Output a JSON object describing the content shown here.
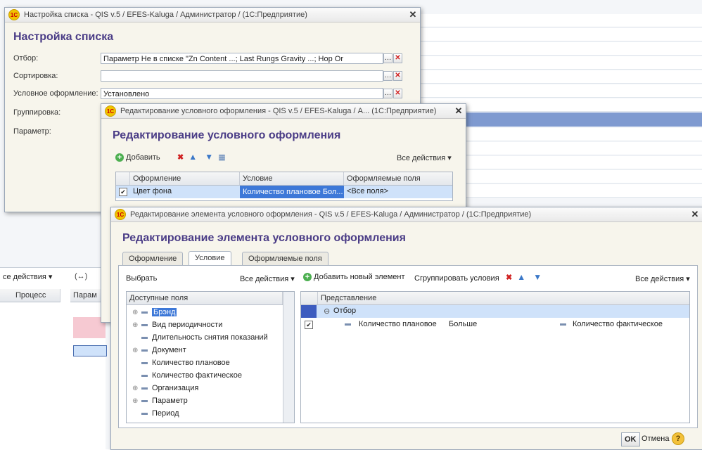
{
  "colors": {
    "heading": "#4a3c86",
    "selection": "#7f9ad0",
    "rowHighlight": "#cfe2fa"
  },
  "background": {
    "actions_label": "се действия ▾",
    "process_col": "Процесс",
    "param_col": "Парам",
    "arrows": "(↔)"
  },
  "win1": {
    "title": "Настройка списка - QIS v.5 / EFES-Kaluga / Администратор /  (1С:Предприятие)",
    "heading": "Настройка списка",
    "filter_label": "Отбор:",
    "filter_value": "Параметр Не в списке \"Zn Content            ...; Last Rungs Gravity      ...; Hop Or",
    "sort_label": "Сортировка:",
    "sort_value": "",
    "cond_label": "Условное оформление:",
    "cond_value": "Установлено",
    "group_label": "Группировка:",
    "param_label": "Параметр:"
  },
  "win2": {
    "title": "Редактирование условного оформления - QIS v.5 / EFES-Kaluga / А...  (1С:Предприятие)",
    "heading": "Редактирование условного оформления",
    "add_label": "Добавить",
    "all_actions": "Все действия ▾",
    "columns": [
      "Оформление",
      "Условие",
      "Оформляемые поля"
    ],
    "row": {
      "style": "Цвет фона",
      "condition": "Количество плановое Бол...",
      "fields": "<Все поля>"
    }
  },
  "win3": {
    "title": "Редактирование элемента условного оформления - QIS v.5 / EFES-Kaluga / Администратор /  (1С:Предприятие)",
    "heading": "Редактирование элемента условного оформления",
    "tabs": [
      "Оформление",
      "Условие",
      "Оформляемые поля"
    ],
    "select_label": "Выбрать",
    "all_actions_left": "Все действия ▾",
    "add_new": "Добавить новый элемент",
    "group_conditions": "Сгруппировать условия",
    "all_actions_right": "Все действия ▾",
    "fields_header": "Доступные поля",
    "fields": [
      "Брэнд",
      "Вид периодичности",
      "Длительность снятия показаний",
      "Документ",
      "Количество плановое",
      "Количество фактическое",
      "Организация",
      "Параметр",
      "Период"
    ],
    "repr_header": "Представление",
    "group_row": "Отбор",
    "cond_row": {
      "left": "Количество плановое",
      "op": "Больше",
      "right": "Количество фактическое"
    },
    "ok": "OK",
    "cancel": "Отмена",
    "help": "?"
  }
}
